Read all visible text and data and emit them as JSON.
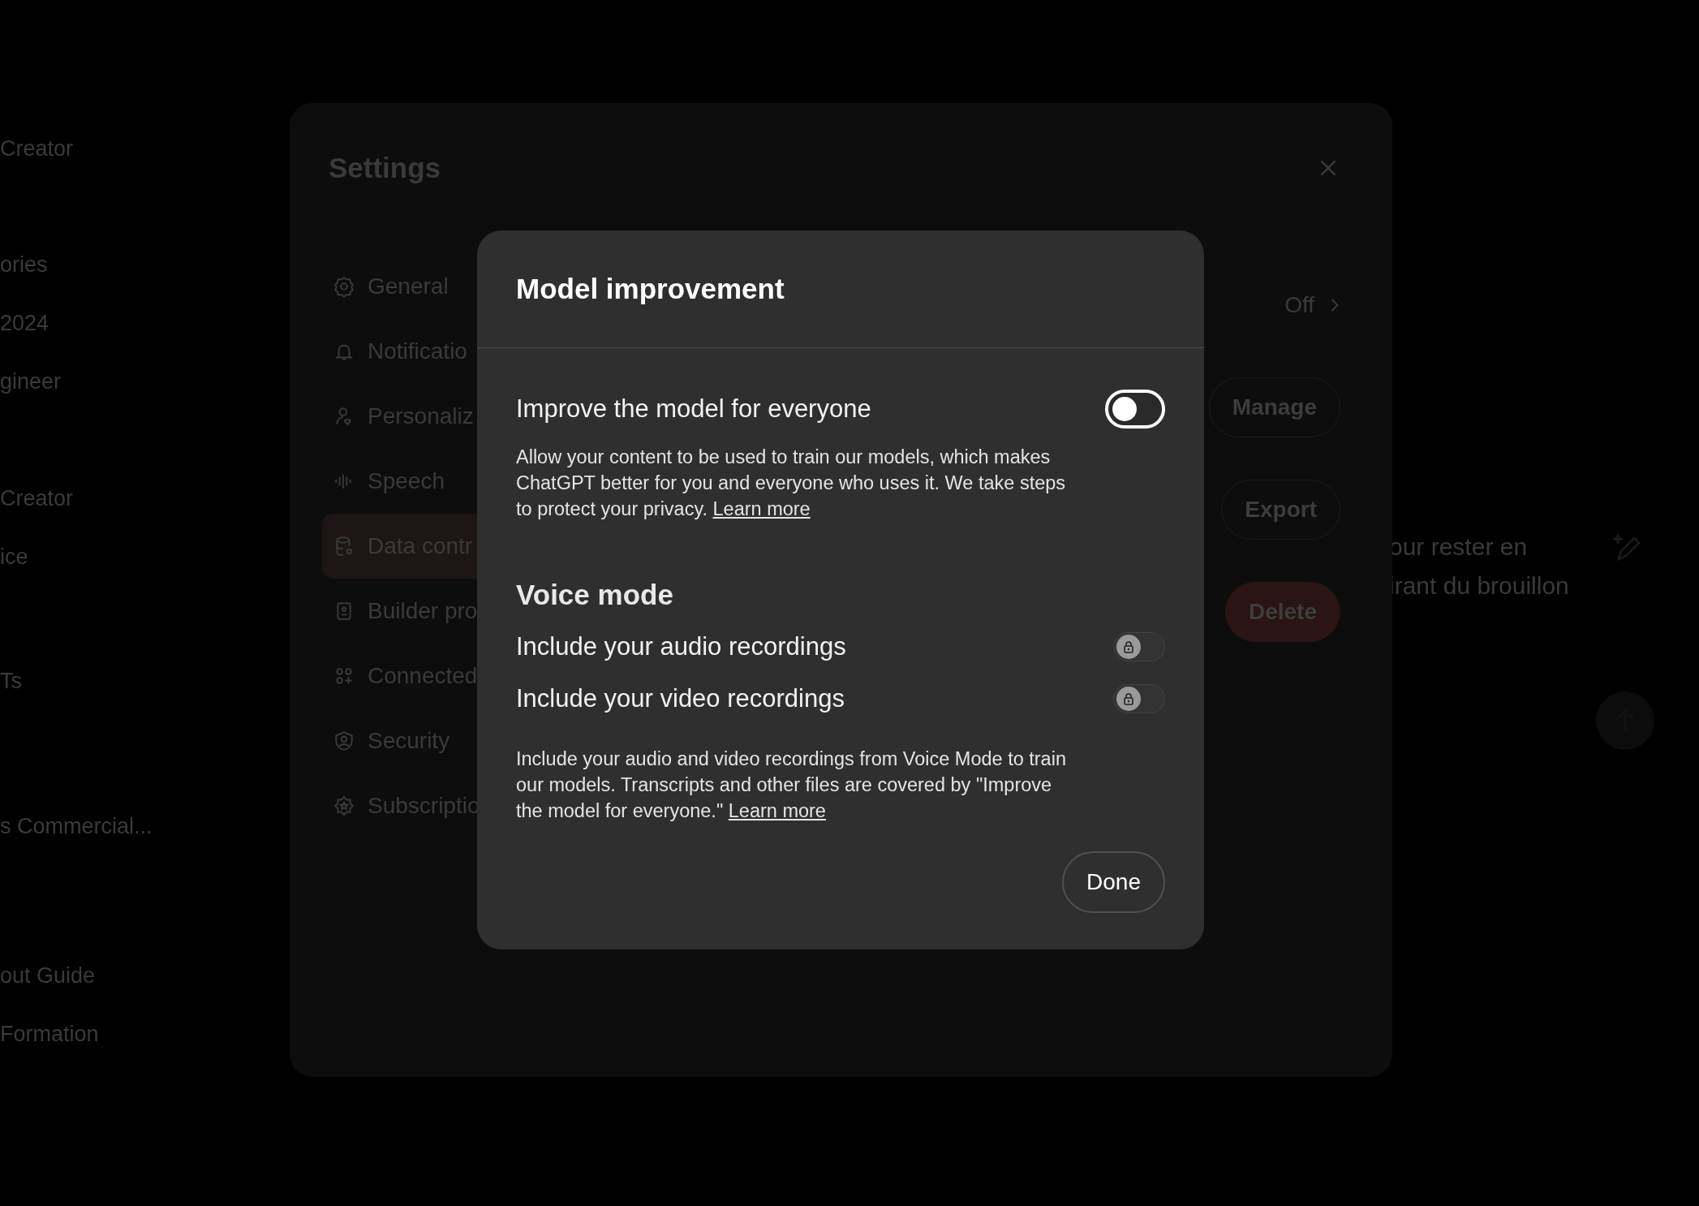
{
  "chat_sidebar": {
    "items": [
      "Creator",
      "ories",
      "2024",
      "gineer",
      "Creator",
      "ice",
      "Ts",
      "s Commercial...",
      "out Guide",
      "Formation"
    ]
  },
  "chat_message": {
    "lines": [
      "our rester en",
      "irant du brouillon"
    ]
  },
  "settings": {
    "title": "Settings",
    "nav": [
      {
        "label": "General",
        "selected": false
      },
      {
        "label": "Notificatio",
        "selected": false
      },
      {
        "label": "Personaliz",
        "selected": false
      },
      {
        "label": "Speech",
        "selected": false
      },
      {
        "label": "Data contr",
        "selected": true
      },
      {
        "label": "Builder pro",
        "selected": false
      },
      {
        "label": "Connected",
        "selected": false
      },
      {
        "label": "Security",
        "selected": false
      },
      {
        "label": "Subscriptio",
        "selected": false
      }
    ],
    "value": "Off",
    "buttons": [
      {
        "label": "Manage",
        "kind": "normal"
      },
      {
        "label": "Export",
        "kind": "normal"
      },
      {
        "label": "Delete",
        "kind": "danger"
      }
    ]
  },
  "modal": {
    "title": "Model improvement",
    "improve": {
      "label": "Improve the model for everyone",
      "on": false,
      "text": "Allow your content to be used to train our models, which makes ChatGPT better for you and everyone who uses it. We take steps to protect your privacy.",
      "link": "Learn more"
    },
    "voice": {
      "heading": "Voice mode",
      "rows": [
        {
          "label": "Include your audio recordings",
          "on": false,
          "locked": true
        },
        {
          "label": "Include your video recordings",
          "on": false,
          "locked": true
        }
      ],
      "text": "Include your audio and video recordings from Voice Mode to train our models. Transcripts and other files are covered by \"Improve the model for everyone.\"",
      "link": "Learn more"
    },
    "done": "Done"
  }
}
